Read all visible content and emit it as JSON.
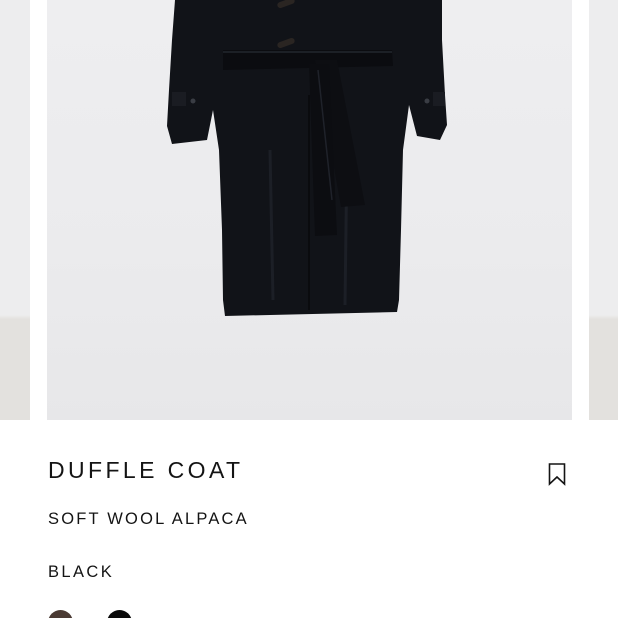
{
  "product": {
    "name": "DUFFLE COAT",
    "material": "SOFT WOOL ALPACA",
    "color": "BLACK"
  },
  "colors": {
    "swatch_brown": "#4a3a33",
    "swatch_black": "#0a0a0a",
    "coat": "#101217",
    "background": "#ffffff"
  },
  "icons": {
    "bookmark": "bookmark-icon"
  }
}
